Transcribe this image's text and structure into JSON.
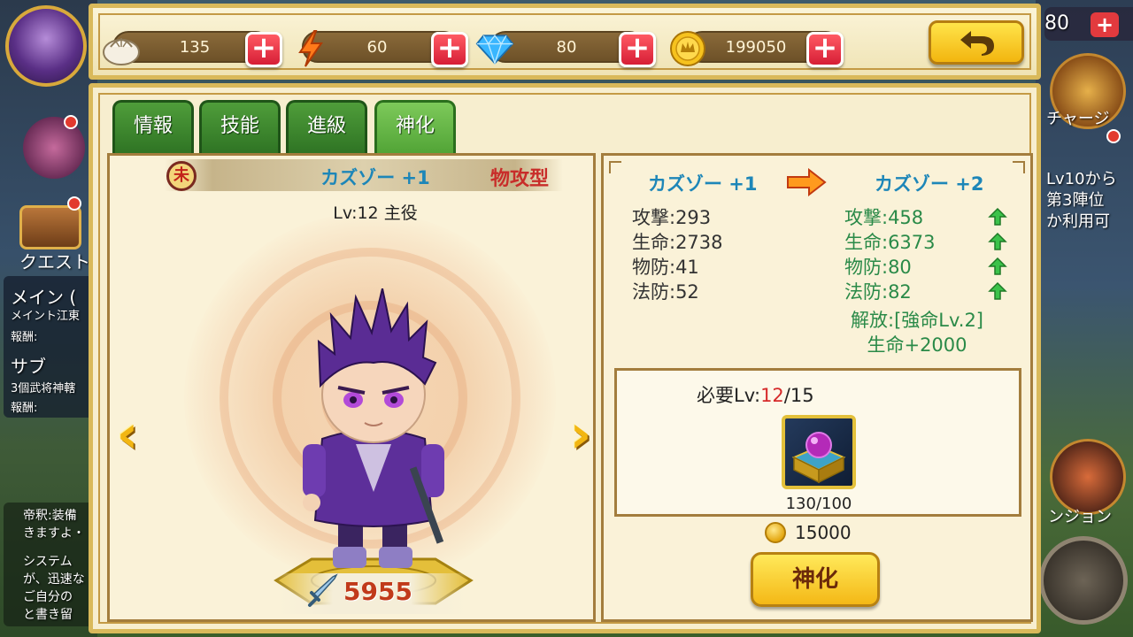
{
  "background": {
    "left_labels": [
      "クエスト",
      "メイン (",
      "メイント江東",
      "報酬:",
      "サブ",
      "3個武将神轄",
      "報酬:",
      "帝釈:装備",
      "きますよ・",
      "システム",
      "が、迅速な",
      "ご自分の",
      "と書き留"
    ],
    "right_labels": [
      "チャージ",
      "Lv10から",
      "第3陣位",
      "か利用可",
      "ンジョン"
    ],
    "right_top_value": "80"
  },
  "resources": {
    "food": "135",
    "stamina": "60",
    "gems": "80",
    "gold": "199050",
    "plus_label": "+"
  },
  "tabs": [
    {
      "label": "情報"
    },
    {
      "label": "技能"
    },
    {
      "label": "進級"
    },
    {
      "label": "神化",
      "active": true
    }
  ],
  "character": {
    "sign": "未",
    "name": "カズゾー +1",
    "type": "物攻型",
    "level": "Lv:12 主役",
    "power": "5955"
  },
  "nav": {
    "prev": "‹",
    "next": "›"
  },
  "compare": {
    "current_name": "カズゾー +1",
    "next_name": "カズゾー +2",
    "current_stats": [
      "攻撃:293",
      "生命:2738",
      "物防:41",
      "法防:52"
    ],
    "next_stats": [
      "攻撃:458",
      "生命:6373",
      "物防:80",
      "法防:82"
    ],
    "unlock_line1": "解放:[強命Lv.2]",
    "unlock_line2": "生命+2000"
  },
  "requirement": {
    "label": "必要Lv:",
    "current": "12",
    "required": "/15",
    "item_count": "130/100",
    "cost": "15000"
  },
  "action_button": "神化",
  "colors": {
    "accent_gold": "#f2b612",
    "tab_green": "#4f9d3a",
    "name_blue": "#1d86b8",
    "type_red": "#c82d2a",
    "stat_green": "#2a8a48"
  }
}
